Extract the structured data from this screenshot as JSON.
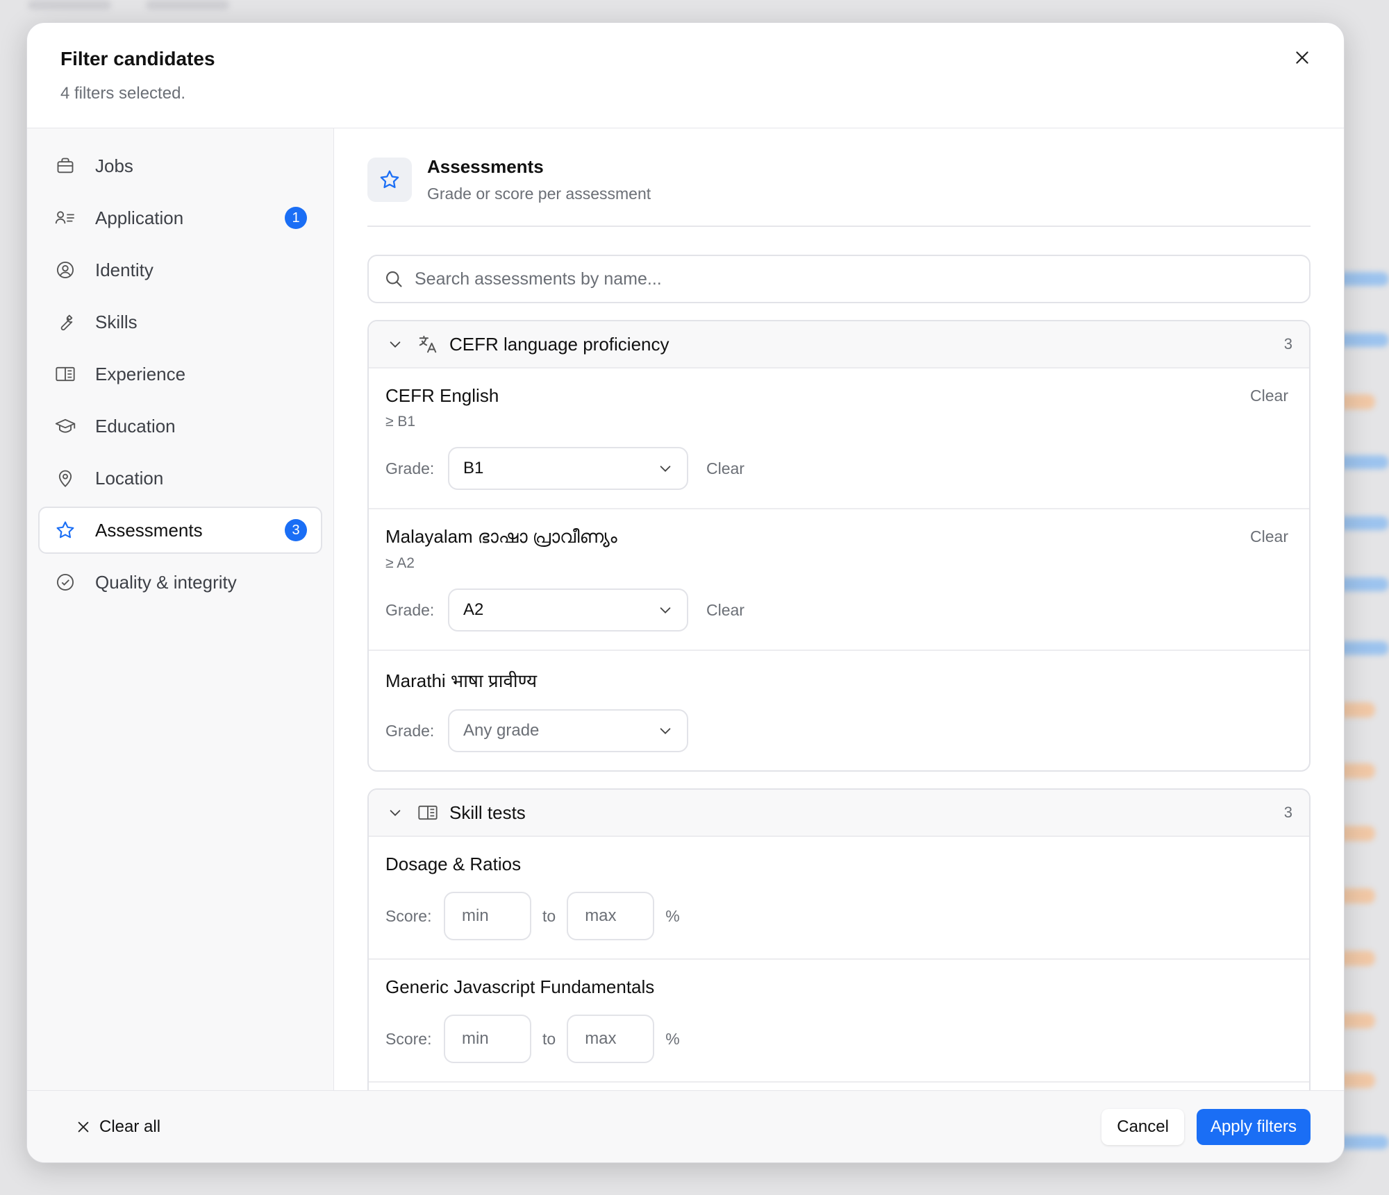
{
  "modal": {
    "title": "Filter candidates",
    "subtitle": "4 filters selected."
  },
  "sidebar": {
    "items": [
      {
        "label": "Jobs",
        "icon": "briefcase-icon",
        "badge": ""
      },
      {
        "label": "Application",
        "icon": "person-list-icon",
        "badge": "1"
      },
      {
        "label": "Identity",
        "icon": "user-circle-icon",
        "badge": ""
      },
      {
        "label": "Skills",
        "icon": "wrench-icon",
        "badge": ""
      },
      {
        "label": "Experience",
        "icon": "book-open-icon",
        "badge": ""
      },
      {
        "label": "Education",
        "icon": "graduation-cap-icon",
        "badge": ""
      },
      {
        "label": "Location",
        "icon": "map-pin-icon",
        "badge": ""
      },
      {
        "label": "Assessments",
        "icon": "star-icon",
        "badge": "3",
        "active": true
      },
      {
        "label": "Quality & integrity",
        "icon": "check-circle-icon",
        "badge": ""
      }
    ]
  },
  "section": {
    "title": "Assessments",
    "description": "Grade or score per assessment"
  },
  "search": {
    "placeholder": "Search assessments by name..."
  },
  "groups": {
    "cefr": {
      "title": "CEFR language proficiency",
      "count": "3",
      "items": [
        {
          "name": "CEFR English",
          "sub": "≥ B1",
          "clear": "Clear",
          "grade_label": "Grade:",
          "grade": "B1",
          "inline_clear": "Clear"
        },
        {
          "name": "Malayalam ഭാഷാ പ്രാവീണ്യം",
          "sub": "≥ A2",
          "clear": "Clear",
          "grade_label": "Grade:",
          "grade": "A2",
          "inline_clear": "Clear"
        },
        {
          "name": "Marathi भाषा प्रावीण्य",
          "grade_label": "Grade:",
          "grade": "Any grade"
        }
      ]
    },
    "skills": {
      "title": "Skill tests",
      "count": "3",
      "items": [
        {
          "name": "Dosage & Ratios",
          "score_label": "Score:",
          "min_placeholder": "min",
          "to": "to",
          "max_placeholder": "max",
          "unit": "%"
        },
        {
          "name": "Generic Javascript Fundamentals",
          "score_label": "Score:",
          "min_placeholder": "min",
          "to": "to",
          "max_placeholder": "max",
          "unit": "%"
        }
      ]
    }
  },
  "footer": {
    "clear_all": "Clear all",
    "cancel": "Cancel",
    "apply": "Apply filters"
  },
  "colors": {
    "accent": "#1a6ef5",
    "muted_text": "#6b6f76",
    "border": "#e2e3e8"
  }
}
